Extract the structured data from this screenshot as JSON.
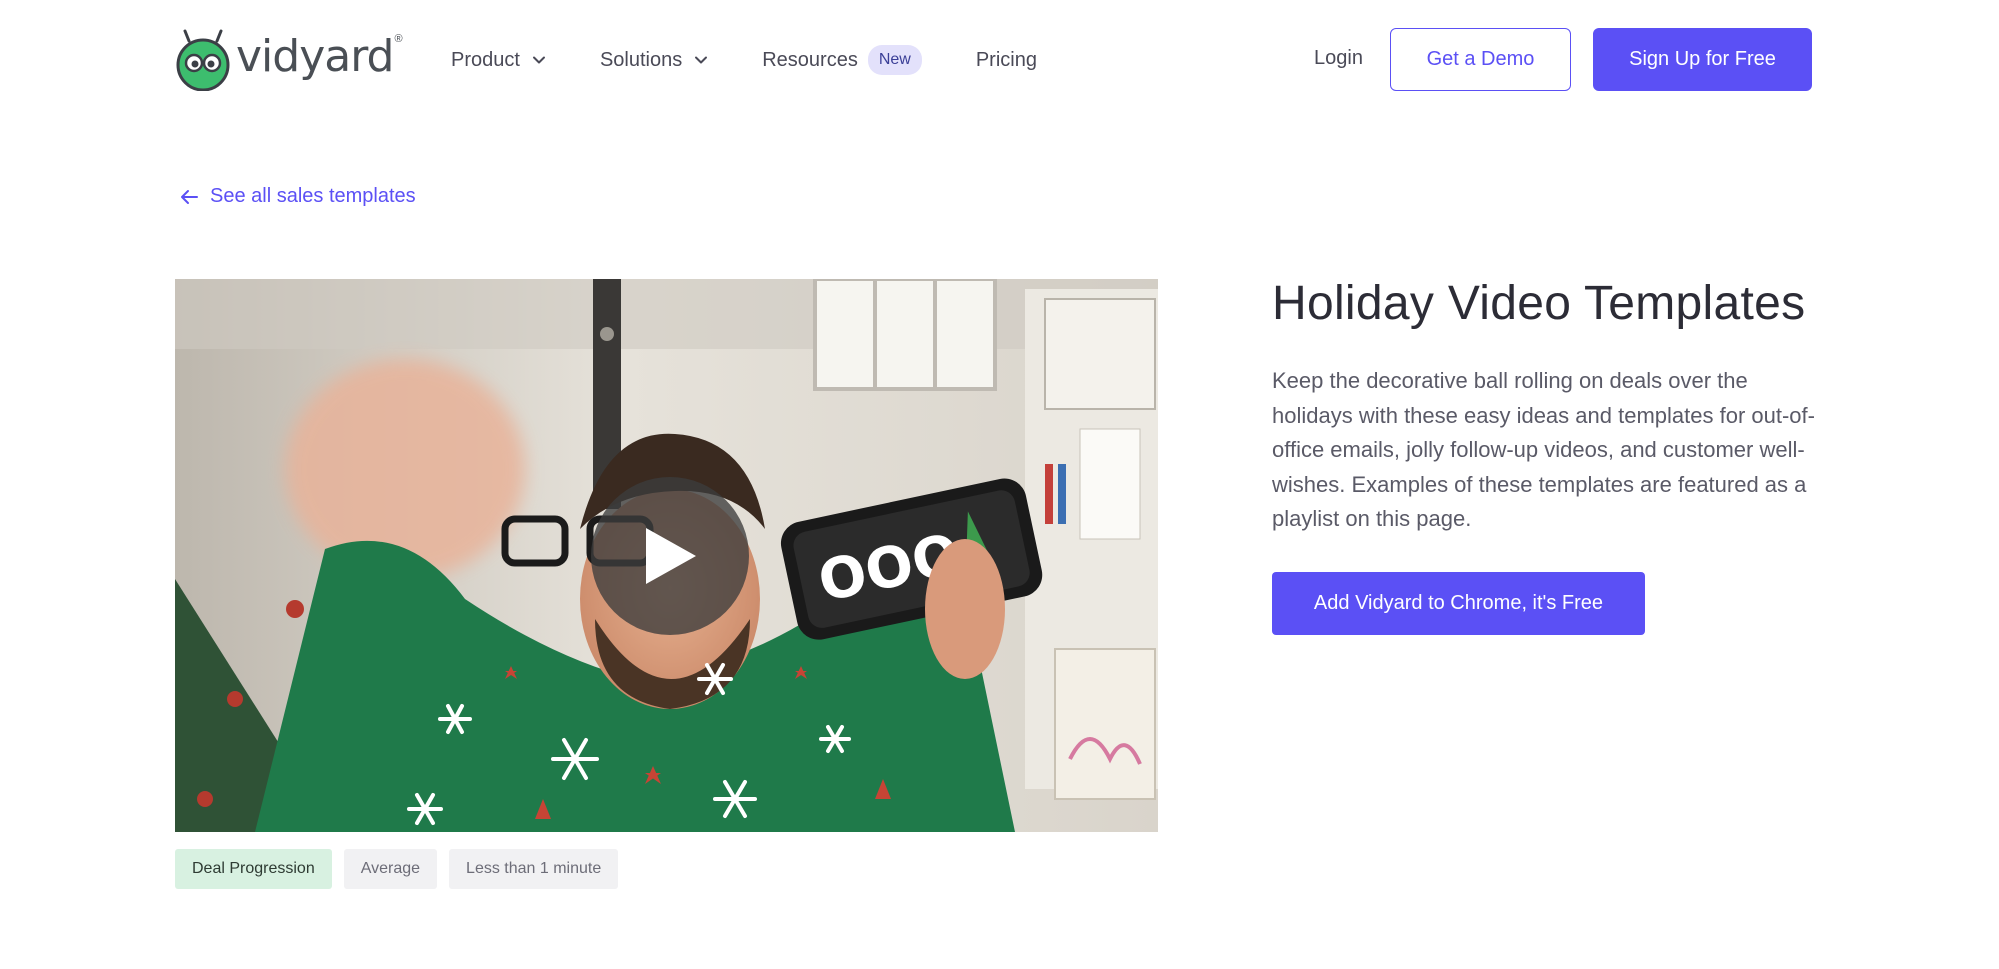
{
  "header": {
    "logo_text": "vidyard",
    "logo_mark": "®",
    "nav": {
      "product": "Product",
      "solutions": "Solutions",
      "resources": "Resources",
      "resources_badge": "New",
      "pricing": "Pricing"
    },
    "login": "Login",
    "demo_button": "Get a Demo",
    "signup_button": "Sign Up for Free"
  },
  "back_link": "See all sales templates",
  "hero": {
    "title": "Holiday Video Templates",
    "description": "Keep the decorative ball rolling on deals over the holidays with these easy ideas and templates for out-of-office emails, jolly follow-up videos, and customer well-wishes. Examples of these templates are featured as a playlist on this page.",
    "cta_button": "Add Vidyard to Chrome, it's Free"
  },
  "video": {
    "phone_text": "OOO"
  },
  "tags": {
    "stage": "Deal Progression",
    "difficulty": "Average",
    "duration": "Less than 1 minute"
  },
  "colors": {
    "brand": "#5b50f5",
    "tag_green": "#d8f1e1",
    "logo_green": "#3dbd6e"
  }
}
